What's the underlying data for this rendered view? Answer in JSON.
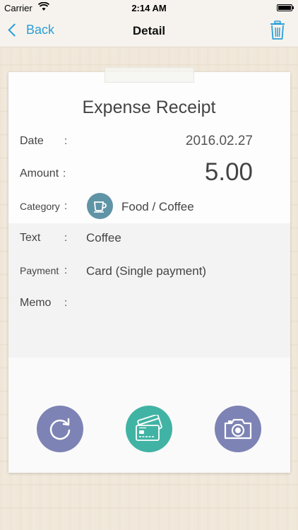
{
  "status": {
    "carrier": "Carrier",
    "time": "2:14 AM"
  },
  "nav": {
    "back_label": "Back",
    "title": "Detail"
  },
  "receipt": {
    "title": "Expense Receipt",
    "fields": {
      "date_label": "Date",
      "date_value": "2016.02.27",
      "amount_label": "Amount",
      "amount_value": "5.00",
      "category_label": "Category",
      "category_value": "Food / Coffee",
      "text_label": "Text",
      "text_value": "Coffee",
      "payment_label": "Payment",
      "payment_value": "Card (Single payment)",
      "memo_label": "Memo",
      "memo_value": ""
    },
    "colon": ":"
  },
  "icons": {
    "category": "coffee-cup-icon",
    "trash": "trash-icon",
    "refresh": "refresh-icon",
    "card": "credit-card-icon",
    "camera": "camera-icon"
  },
  "colors": {
    "accent": "#2a9fd6",
    "button_purple": "#7e83b5",
    "button_teal": "#41b3a4",
    "category_icon": "#5f94a6"
  }
}
